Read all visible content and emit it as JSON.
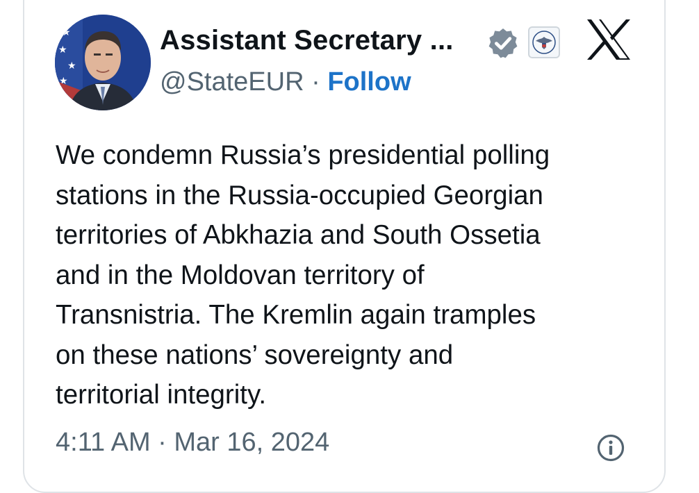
{
  "author": {
    "display_name": "Assistant Secretary ...",
    "handle": "@StateEUR",
    "separator": "·",
    "follow_label": "Follow"
  },
  "post": {
    "lines": [
      "We condemn Russia’s presidential polling",
      "stations in the Russia-occupied Georgian",
      "territories of Abkhazia and South Ossetia",
      "and in the Moldovan territory of",
      "Transnistria. The Kremlin again tramples",
      "on these nations’ sovereignty and",
      "territorial integrity."
    ],
    "timestamp": "4:11 AM · Mar 16, 2024"
  },
  "icons": {
    "verified": "verified-badge-icon",
    "affiliation": "us-state-department-seal-icon",
    "platform": "x-logo-icon",
    "info": "info-icon"
  },
  "colors": {
    "text": "#0f1419",
    "secondary": "#536471",
    "link": "#1d73c8",
    "badge": "#7d8b99",
    "border": "#dfe3e7"
  }
}
